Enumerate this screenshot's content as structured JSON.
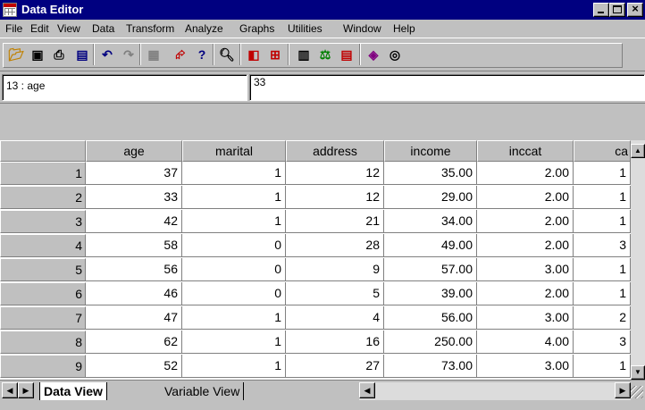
{
  "window": {
    "title": "Data Editor"
  },
  "menu": [
    "File",
    "Edit",
    "View",
    "Data",
    "Transform",
    "Analyze",
    "Graphs",
    "Utilities",
    "Window",
    "Help"
  ],
  "toolbar": {
    "icons": [
      "open-icon",
      "save-icon",
      "print-icon",
      "dialog-recall-icon",
      "undo-icon",
      "redo-icon",
      "goto-chart-icon",
      "goto-case-icon",
      "variables-icon",
      "find-icon",
      "insert-variable-icon",
      "insert-case-icon",
      "split-file-icon",
      "weight-cases-icon",
      "select-cases-icon",
      "value-labels-icon",
      "use-sets-icon"
    ]
  },
  "cell_editor": {
    "reference": "13 : age",
    "value": "33"
  },
  "columns": [
    "age",
    "marital",
    "address",
    "income",
    "inccat",
    "ca"
  ],
  "rows": [
    {
      "n": "1",
      "cells": [
        "37",
        "1",
        "12",
        "35.00",
        "2.00",
        "1"
      ]
    },
    {
      "n": "2",
      "cells": [
        "33",
        "1",
        "12",
        "29.00",
        "2.00",
        "1"
      ]
    },
    {
      "n": "3",
      "cells": [
        "42",
        "1",
        "21",
        "34.00",
        "2.00",
        "1"
      ]
    },
    {
      "n": "4",
      "cells": [
        "58",
        "0",
        "28",
        "49.00",
        "2.00",
        "3"
      ]
    },
    {
      "n": "5",
      "cells": [
        "56",
        "0",
        "9",
        "57.00",
        "3.00",
        "1"
      ]
    },
    {
      "n": "6",
      "cells": [
        "46",
        "0",
        "5",
        "39.00",
        "2.00",
        "1"
      ]
    },
    {
      "n": "7",
      "cells": [
        "47",
        "1",
        "4",
        "56.00",
        "3.00",
        "2"
      ]
    },
    {
      "n": "8",
      "cells": [
        "62",
        "1",
        "16",
        "250.00",
        "4.00",
        "3"
      ]
    },
    {
      "n": "9",
      "cells": [
        "52",
        "1",
        "27",
        "73.00",
        "3.00",
        "1"
      ]
    }
  ],
  "tabs": {
    "data_view": "Data View",
    "variable_view": "Variable View"
  },
  "colors": {
    "titlebar": "#000080",
    "face": "#c0c0c0",
    "cell": "#ffffff"
  }
}
